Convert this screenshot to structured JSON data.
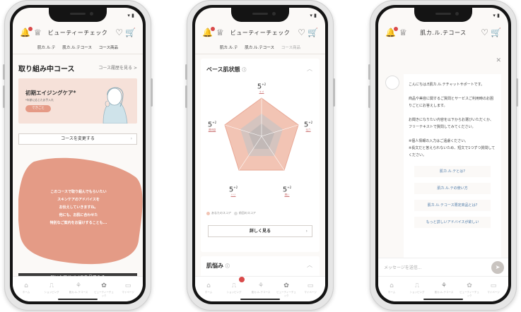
{
  "header": {
    "title": "ビューティーチェック",
    "chat_title": "肌カ.ル.テコース"
  },
  "tabs": [
    "肌カ.ル.テ",
    "肌カ.ル.テコース",
    "コース商品"
  ],
  "nav": [
    "ホーム",
    "ショッピング",
    "肌カ.ル.テコース",
    "ビューティーチェック",
    "マイページ"
  ],
  "screen1": {
    "section_title": "取り組み中コース",
    "history_link": "コース履歴を見る >",
    "card_title": "初期エイジングケア*",
    "card_sub": "*年齢に応じたお手入れ",
    "card_button": "できごと",
    "change_button": "コースを変更する",
    "blob_text": [
      "このコースで取り組んでもらいたい",
      "スキンケアのアドバイスを",
      "お伝えしていきますね。",
      "他にも、お肌に合わせた",
      "特別なご案内をお届けすることも..."
    ],
    "advice_button": "届いたアドバイスを見てみる"
  },
  "screen2": {
    "panel_title": "ベース肌状態",
    "values": [
      {
        "label": "透明感",
        "value": "5",
        "delta": "+2"
      },
      {
        "label": "潤い",
        "value": "5",
        "delta": "+2"
      },
      {
        "label": "ハリ",
        "value": "5",
        "delta": "+2"
      },
      {
        "label": "キメ",
        "value": "5",
        "delta": "+2"
      },
      {
        "label": "毛穴",
        "value": "5",
        "delta": "+2"
      }
    ],
    "legend": [
      "あなたのスコア",
      "前回のスコア"
    ],
    "more_button": "詳しく見る",
    "concerns_title": "肌悩み"
  },
  "screen3": {
    "greeting": "こんにちは♬肌カ.ル.テチャットサポートです。",
    "p2": "商品や美容に関するご質問とサービスご利用時のお困りごとにお答えします。",
    "p3": "お聞きになりたい内容を以下からお選びいただくか、フリーテキストで質問してみてください。",
    "p4": "※個人情報の入力はご遠慮ください。",
    "p5": "※長文だと答えられないため、短文で1つずつ質問してください。",
    "links": [
      "肌カ.ル.テとは?",
      "肌カ.ル.テの使い方",
      "肌カ.ル.テコース限定商品とは?",
      "もっと詳しいアドバイスが欲しい"
    ],
    "input_placeholder": "メッセージを送信..."
  }
}
